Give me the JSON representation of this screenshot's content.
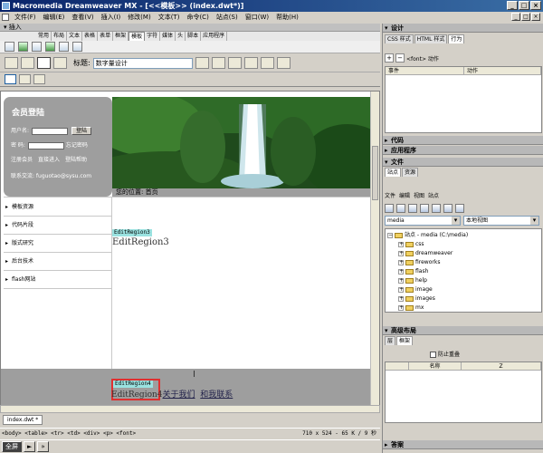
{
  "window": {
    "title": "Macromedia Dreamweaver MX - [<<模板>> (index.dwt*)]"
  },
  "menubar": {
    "items": [
      "文件(F)",
      "编辑(E)",
      "查看(V)",
      "插入(I)",
      "修改(M)",
      "文本(T)",
      "命令(C)",
      "站点(S)",
      "窗口(W)",
      "帮助(H)"
    ]
  },
  "insert_panel": {
    "header": "▾ 插入",
    "tabs": [
      "常用",
      "布局",
      "文本",
      "表格",
      "表单",
      "框架",
      "模板",
      "字符",
      "媒体",
      "头",
      "脚本",
      "应用程序"
    ],
    "active_tab": "模板"
  },
  "doc_toolbar": {
    "title_label": "标题:",
    "title_value": "数字量设计"
  },
  "page": {
    "member_login": {
      "title": "会员登陆",
      "username_label": "用户名:",
      "password_label": "密  码:",
      "login_button": "登陆",
      "forgot_password": "忘记密码",
      "register": "注册会员",
      "direct_enter": "直接进入",
      "login_help": "登陆帮助",
      "contact": "联系交流: fuguotao@sysu.com"
    },
    "breadcrumb": "您的位置: 首页",
    "nav_items": [
      "模板资源",
      "代码片段",
      "版式研究",
      "后台技术",
      "flash网站"
    ],
    "region3_tag": "EditRegion3",
    "region3_text": "EditRegion3",
    "region4_tag": "EditRegion4",
    "region4_text": "EditRegion4",
    "footer_about": "关于我们",
    "footer_contact": "和我联系"
  },
  "document_tab": "index.dwt *",
  "status": {
    "tag_selector": "<body> <table> <tr> <td> <div> <p> <font>",
    "dimensions": "710 x 524 - 65 K / 9 秒"
  },
  "taskbar": {
    "start_label": "全屏",
    "btn2": "►"
  },
  "right_panels": {
    "design_header": "设计",
    "design_tabs": [
      "CSS 样式",
      "HTML 样式",
      "行为"
    ],
    "design_active_tab": "行为",
    "behavior_tag": "<font> 动作",
    "behavior_columns": [
      "事件",
      "动作"
    ],
    "code_header": "代码",
    "app_header": "应用程序",
    "files_header": "文件",
    "files_tabs": [
      "站点",
      "资源"
    ],
    "files_active_tab": "站点",
    "files_menu": [
      "文件",
      "编辑",
      "视图",
      "站点"
    ],
    "site_select": "media",
    "view_select": "本地视图",
    "tree": [
      {
        "label": "站点 - media (C:\\media)",
        "level": 0,
        "expanded": true
      },
      {
        "label": "css",
        "level": 1
      },
      {
        "label": "dreamweaver",
        "level": 1
      },
      {
        "label": "fireworks",
        "level": 1
      },
      {
        "label": "flash",
        "level": 1
      },
      {
        "label": "help",
        "level": 1
      },
      {
        "label": "image",
        "level": 1
      },
      {
        "label": "images",
        "level": 1
      },
      {
        "label": "mx",
        "level": 1
      }
    ],
    "layers_header": "高级布局",
    "layers_tabs": [
      "层",
      "框架"
    ],
    "layers_active_tab": "框架",
    "prevent_overlap": "防止重叠",
    "layers_columns": [
      "",
      "名称",
      "Z"
    ],
    "answers_header": "答案"
  }
}
